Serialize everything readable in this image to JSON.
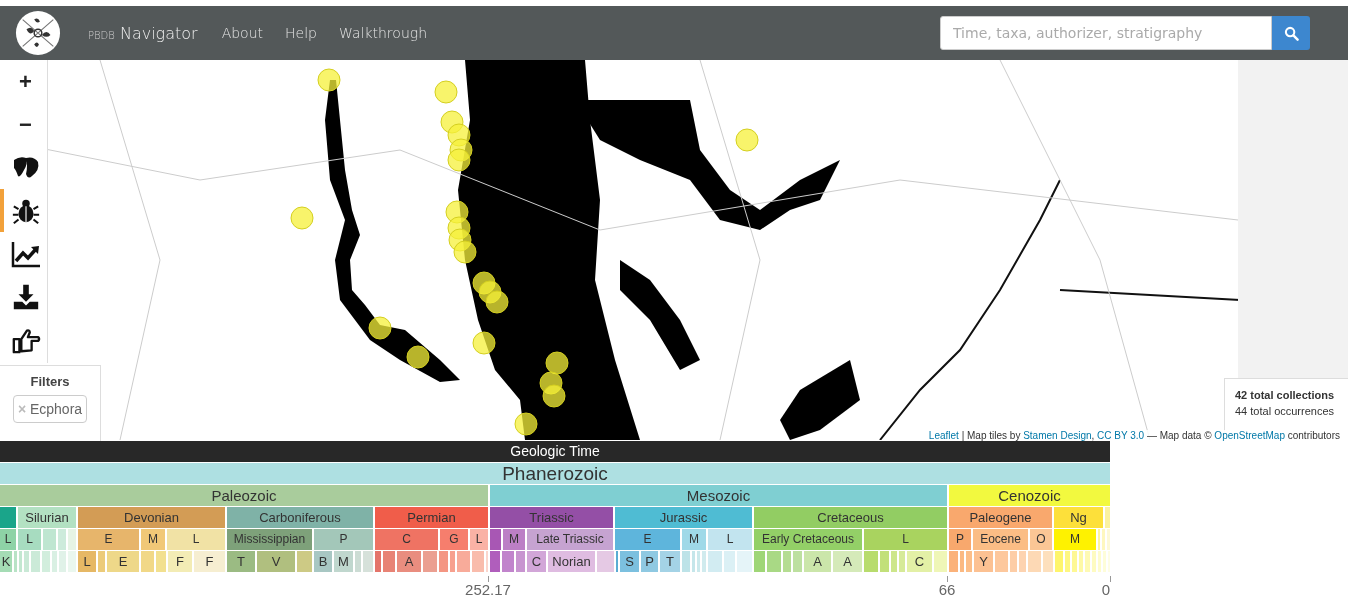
{
  "navbar": {
    "brand_small": "PBDB",
    "brand": "Navigator",
    "links": [
      "About",
      "Help",
      "Walkthrough"
    ],
    "search": {
      "placeholder": "Time, taxa, authorizer, stratigraphy"
    }
  },
  "tools": [
    {
      "kind": "zoom-in",
      "label": "+",
      "selected": false
    },
    {
      "kind": "zoom-out",
      "label": "−",
      "selected": false
    },
    {
      "kind": "map",
      "selected": false
    },
    {
      "kind": "taxa",
      "selected": true
    },
    {
      "kind": "diversity",
      "selected": false
    },
    {
      "kind": "download",
      "selected": false
    },
    {
      "kind": "pointer",
      "selected": false
    }
  ],
  "filters": {
    "title": "Filters",
    "chips": [
      {
        "remove": "×",
        "label": "Ecphora"
      }
    ]
  },
  "stats": {
    "collections": "42 total collections",
    "occurrences": "44 total occurrences"
  },
  "attribution": [
    {
      "kind": "link",
      "text": "Leaflet"
    },
    {
      "kind": "text",
      "text": " | Map tiles by "
    },
    {
      "kind": "link",
      "text": "Stamen Design"
    },
    {
      "kind": "text",
      "text": ", "
    },
    {
      "kind": "link",
      "text": "CC BY 3.0"
    },
    {
      "kind": "text",
      "text": " — Map data © "
    },
    {
      "kind": "link",
      "text": "OpenStreetMap"
    },
    {
      "kind": "text",
      "text": " contributors"
    }
  ],
  "timescale": {
    "title": "Geologic Time",
    "eon": {
      "label": "Phanerozoic",
      "color": "#aee0e2"
    },
    "eras": [
      {
        "label": "Paleozoic",
        "color": "#a9cc9c"
      },
      {
        "label": "Mesozoic",
        "color": "#7fcfd2"
      },
      {
        "label": "Cenozoic",
        "color": "#f2f93f"
      }
    ],
    "periods": [
      {
        "color": "#1aa58a"
      },
      {
        "label": "Silurian",
        "color": "#b3e1c2"
      },
      {
        "label": "Devonian",
        "color": "#d39c55"
      },
      {
        "label": "Carboniferous",
        "color": "#7fb2a7"
      },
      {
        "label": "Permian",
        "color": "#f05d4a"
      },
      {
        "label": "Triassic",
        "color": "#944fa6"
      },
      {
        "label": "Jurassic",
        "color": "#4fbcd3"
      },
      {
        "label": "Cretaceous",
        "color": "#92cd63"
      },
      {
        "label": "Paleogene",
        "color": "#f9a86d"
      },
      {
        "label": "Ng",
        "color": "#fde03a"
      },
      {
        "color": "#fbf2a0"
      }
    ],
    "epochs": [
      {
        "label": "L",
        "color": "#8ed3a6"
      },
      {
        "label": "L",
        "color": "#a7dcc0"
      },
      {
        "color": "#bfe6d1"
      },
      {
        "color": "#cdebdb"
      },
      {
        "color": "#e6f4e5"
      },
      {
        "label": "E",
        "color": "#e7b56b"
      },
      {
        "label": "M",
        "color": "#f1c877"
      },
      {
        "label": "L",
        "color": "#f1e2a5"
      },
      {
        "label": "Mississippian",
        "color": "#7ea17a"
      },
      {
        "label": "P",
        "color": "#a3c7b9"
      },
      {
        "label": "C",
        "color": "#ef7363"
      },
      {
        "label": "G",
        "color": "#f67e6d"
      },
      {
        "label": "L",
        "color": "#fab2a5"
      },
      {
        "color": "#a857b4"
      },
      {
        "label": "M",
        "color": "#bc7fc6"
      },
      {
        "label": "Late Triassic",
        "color": "#c6a3d1"
      },
      {
        "label": "E",
        "color": "#5eb5dc"
      },
      {
        "label": "M",
        "color": "#9fd9e8"
      },
      {
        "label": "L",
        "color": "#c2e4ef"
      },
      {
        "label": "Early Cretaceous",
        "color": "#93d067"
      },
      {
        "label": "L",
        "color": "#a9d35f"
      },
      {
        "label": "P",
        "color": "#f8a86d"
      },
      {
        "label": "Eocene",
        "color": "#fbbd85"
      },
      {
        "label": "O",
        "color": "#fbc695"
      },
      {
        "label": "M",
        "color": "#fef200"
      },
      {
        "color": "#fef69b"
      },
      {
        "color": "#fef7bf"
      },
      {
        "color": "#fdf9d7"
      }
    ],
    "stages": [
      {
        "label": "K",
        "color": "#a5dcb5"
      },
      {
        "color": "#b8e3c6"
      },
      {
        "color": "#c2e7d0"
      },
      {
        "color": "#c9e9d6"
      },
      {
        "color": "#cbead8"
      },
      {
        "color": "#d2eedd"
      },
      {
        "color": "#d9f0e3"
      },
      {
        "color": "#e0f2e8"
      },
      {
        "color": "#eaf7ee"
      },
      {
        "label": "L",
        "color": "#e6b865"
      },
      {
        "color": "#eccb7a"
      },
      {
        "label": "E",
        "color": "#eed889"
      },
      {
        "color": "#f1d887"
      },
      {
        "color": "#f2e08f"
      },
      {
        "label": "F",
        "color": "#f3ecb5"
      },
      {
        "label": "F",
        "color": "#f6eed1"
      },
      {
        "label": "T",
        "color": "#9bbb83"
      },
      {
        "label": "V",
        "color": "#b0bf7f"
      },
      {
        "color": "#cdca85"
      },
      {
        "label": "B",
        "color": "#a8c7c3"
      },
      {
        "label": "M",
        "color": "#c0d7ce"
      },
      {
        "color": "#ccdcd4"
      },
      {
        "color": "#d6e1da"
      },
      {
        "color": "#e4746a"
      },
      {
        "color": "#e88375"
      },
      {
        "label": "A",
        "color": "#e98d7f"
      },
      {
        "color": "#eb9f91"
      },
      {
        "color": "#f49683"
      },
      {
        "color": "#f7a08e"
      },
      {
        "color": "#f8ab9a"
      },
      {
        "color": "#f9bcac"
      },
      {
        "color": "#fbd6cd"
      },
      {
        "color": "#b05ebc"
      },
      {
        "color": "#c184cc"
      },
      {
        "color": "#c894d0"
      },
      {
        "label": "C",
        "color": "#d2a6d8"
      },
      {
        "label": "Norian",
        "color": "#dfbce1"
      },
      {
        "color": "#e5c9e4"
      },
      {
        "color": "#5aacd3"
      },
      {
        "label": "S",
        "color": "#7cc0df"
      },
      {
        "label": "P",
        "color": "#8fc9e2"
      },
      {
        "label": "T",
        "color": "#a4d3e6"
      },
      {
        "color": "#bde3e8"
      },
      {
        "color": "#c5e6ea"
      },
      {
        "color": "#cbe9ec"
      },
      {
        "color": "#d0ebee"
      },
      {
        "color": "#d2ecf2"
      },
      {
        "color": "#dbf0f5"
      },
      {
        "color": "#e5f4f8"
      },
      {
        "color": "#9fd677"
      },
      {
        "color": "#a9d985"
      },
      {
        "color": "#b5dd92"
      },
      {
        "color": "#bde0a0"
      },
      {
        "label": "A",
        "color": "#cbe6aa"
      },
      {
        "label": "A",
        "color": "#d5eab9"
      },
      {
        "color": "#b8dc6d"
      },
      {
        "color": "#c2e07a"
      },
      {
        "color": "#cde68b"
      },
      {
        "color": "#d6ea98"
      },
      {
        "label": "C",
        "color": "#e3f0a6"
      },
      {
        "color": "#eff6b7"
      },
      {
        "color": "#fbb27a"
      },
      {
        "color": "#fbb982"
      },
      {
        "color": "#fcbe88"
      },
      {
        "label": "Y",
        "color": "#fcc192"
      },
      {
        "color": "#fdc89d"
      },
      {
        "color": "#fdcda6"
      },
      {
        "color": "#fdd3b0"
      },
      {
        "color": "#fdd9b5"
      },
      {
        "color": "#fde0bd"
      },
      {
        "color": "#fef56c"
      },
      {
        "color": "#fef781"
      },
      {
        "color": "#fef894"
      },
      {
        "color": "#fef9a5"
      },
      {
        "color": "#fefab4"
      },
      {
        "color": "#fefbc1"
      },
      {
        "color": "#fefccd"
      },
      {
        "color": "#fefdd9"
      },
      {
        "color": "#fefde5"
      }
    ],
    "ticks": [
      "252.17",
      "66",
      "0"
    ]
  }
}
